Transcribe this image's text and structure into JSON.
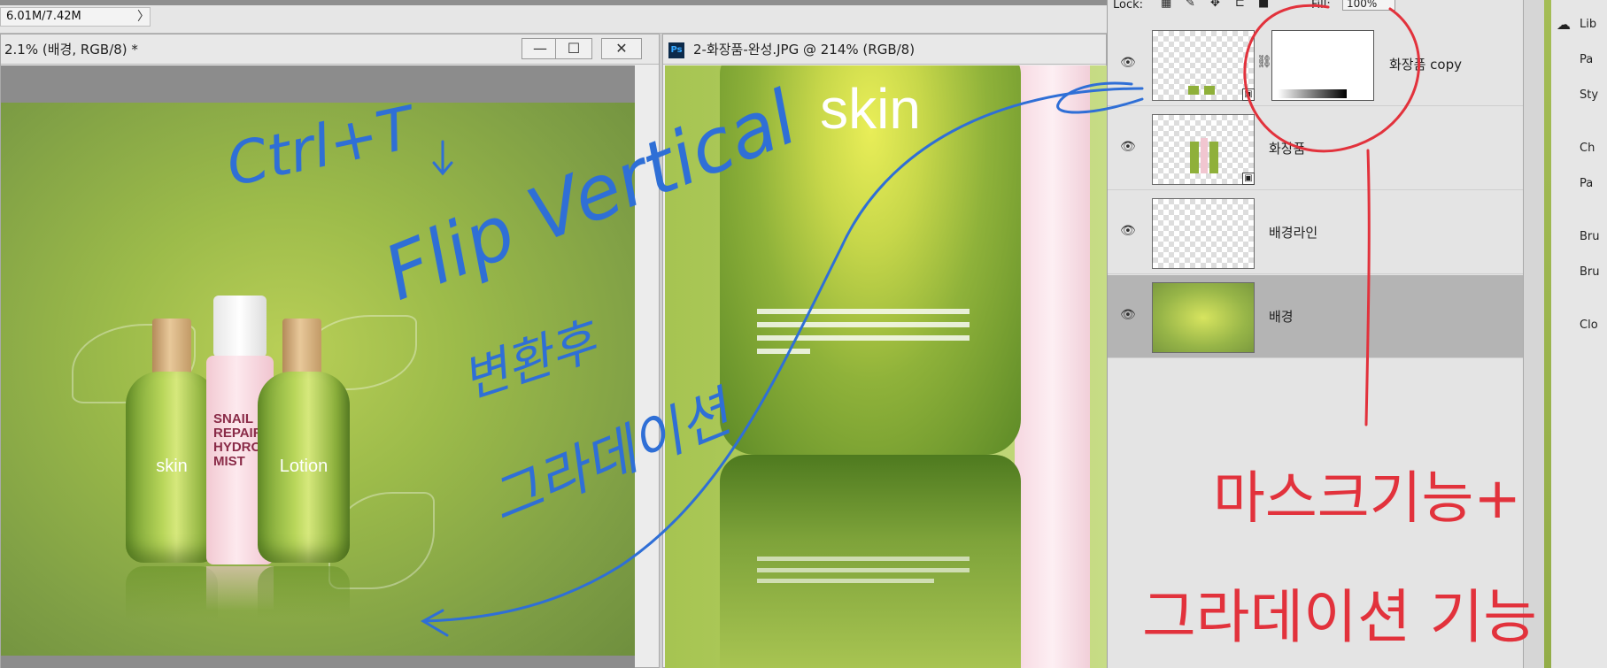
{
  "status": {
    "doc_size": "6.01M/7.42M",
    "arrow": "〉"
  },
  "left_doc": {
    "title": "2.1% (배경, RGB/8) *",
    "buttons": {
      "minimize": "—",
      "maximize": "☐",
      "close": "✕"
    },
    "bottle_labels": [
      "skin",
      "SNAIL",
      "REPAIR",
      "HYDRO",
      "MIST",
      "Lotion"
    ]
  },
  "right_doc": {
    "title": "2-화장품-완성.JPG @ 214% (RGB/8)",
    "ps_badge": "Ps",
    "skin_label": "skin"
  },
  "layers": {
    "lock_label": "Lock:",
    "fill_label": "Fill:",
    "fill_value": "100%",
    "items": [
      {
        "name": "화장품 copy",
        "visible": true,
        "has_mask": true
      },
      {
        "name": "화장품",
        "visible": true
      },
      {
        "name": "배경라인",
        "visible": true
      },
      {
        "name": "배경",
        "visible": true,
        "selected": true
      }
    ]
  },
  "right_panel": {
    "items": [
      "Lib",
      "Pa",
      "Sty",
      "Ch",
      "Pa",
      "Bru",
      "Bru",
      "Clo"
    ]
  },
  "annotations": {
    "blue": [
      "Ctrl+T",
      "↓",
      "Flip Vertical",
      "변환후",
      "그라데이션"
    ],
    "red": [
      "마스크기능+",
      "그라데이션 기능"
    ]
  },
  "colors": {
    "annot_blue": "#2f6fd6",
    "annot_red": "#e2323c"
  }
}
